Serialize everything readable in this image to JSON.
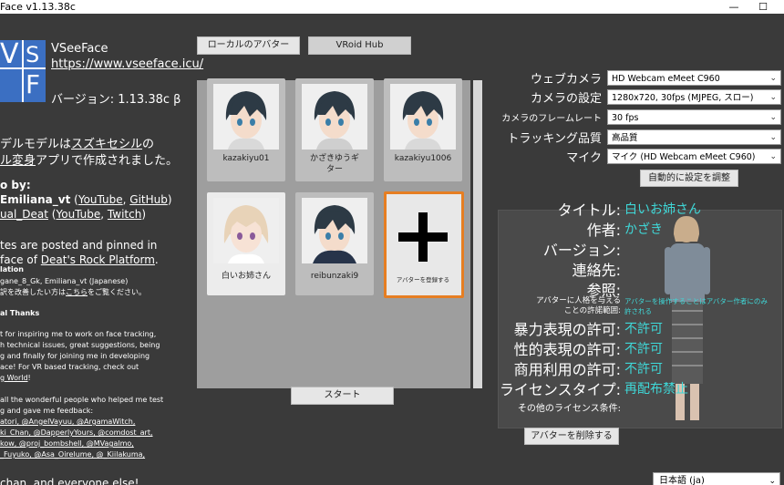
{
  "window": {
    "title": "Face v1.13.38c",
    "minimize": "—",
    "maximize": "☐"
  },
  "logo": {
    "letters": [
      "V",
      "S",
      "F"
    ]
  },
  "left": {
    "app_name": "VSeeFace",
    "url": "https://www.vseeface.icu/",
    "version": "バージョン: 1.13.38c β",
    "desc_line1_a": "デルモデルは",
    "desc_line1_link": "スズキセシル",
    "desc_line1_b": "の",
    "desc_line2_link": "ル変身",
    "desc_line2_b": "アプリで作成されました。",
    "credit_head": "o by:",
    "credit_l1_a": "Emiliana_vt",
    "credit_l1_b": " (",
    "credit_l1_yt": "YouTube",
    "credit_l1_c": ", ",
    "credit_l1_gh": "GitHub",
    "credit_l1_d": ")",
    "credit_l2_a": "ual_Deat",
    "credit_l2_b": " (",
    "credit_l2_yt": "YouTube",
    "credit_l2_c": ", ",
    "credit_l2_tw": "Twitch",
    "credit_l2_d": ")",
    "updates_l1": "tes are posted and pinned in",
    "updates_l2_a": "face of ",
    "updates_l2_link": "Deat's Rock Platform",
    "updates_l2_b": ".",
    "translation_head": "lation",
    "translation_l1": "gane_8_Gk, Emiliana_vt (Japanese)",
    "translation_l2_a": "訳を改善したい方は",
    "translation_l2_link": "こちら",
    "translation_l2_b": "をご覧ください。",
    "thanks_head": "al Thanks",
    "thanks_lines": [
      "t for inspiring me to work on face tracking,",
      "h technical issues, great suggestions, being",
      "g and finally for joining me in developing",
      "ace! For VR based tracking, check out"
    ],
    "thanks_last_a": "g World",
    "thanks_last_b": "!",
    "testers_lines": [
      "all the wonderful people who helped me test",
      "g and gave me feedback:",
      "atori, @AngelVayuu, @ArgamaWitch,",
      "ki_Chan, @DapperlyYours, @comdost_art,",
      "kow, @proj_bombshell, @MVagalmo,",
      "_Fuyuko, @Asa_Oirelume, @_Kiilakuma,"
    ],
    "everyone_a": "chan",
    "everyone_b": ", and everyone else!"
  },
  "tabs": {
    "local": "ローカルのアバター",
    "vroid": "VRoid Hub"
  },
  "avatars": [
    {
      "name": "kazakiyu01"
    },
    {
      "name": "かざきゆうギター"
    },
    {
      "name": "kazakiyu1006"
    },
    {
      "name": "白いお姉さん"
    },
    {
      "name": "reibunzaki9"
    }
  ],
  "add_avatar_label": "アバターを登録する",
  "start_button": "スタート",
  "settings": {
    "webcam_label": "ウェブカメラ",
    "webcam_value": "HD Webcam eMeet C960",
    "camera_settings_label": "カメラの設定",
    "camera_settings_value": "1280x720, 30fps (MJPEG, スロー)",
    "framerate_label": "カメラのフレームレート",
    "framerate_value": "30 fps",
    "quality_label": "トラッキング品質",
    "quality_value": "高品質",
    "mic_label": "マイク",
    "mic_value": "マイク (HD Webcam eMeet C960)",
    "auto_adjust": "自動的に設定を調整",
    "arrow": "⌄"
  },
  "avatar_info": {
    "title_label": "タイトル:",
    "title_value": "白いお姉さん",
    "author_label": "作者:",
    "author_value": "かざき",
    "version_label": "バージョン:",
    "contact_label": "連絡先:",
    "reference_label": "参照:",
    "persona_label_1": "アバターに人格を与える",
    "persona_label_2": "ことの許諾範囲:",
    "persona_value_1": "アバターを操作することはアバター作者にのみ",
    "persona_value_2": "許される",
    "violence_label": "暴力表現の許可:",
    "violence_value": "不許可",
    "sexual_label": "性的表現の許可:",
    "sexual_value": "不許可",
    "commercial_label": "商用利用の許可:",
    "commercial_value": "不許可",
    "license_label": "ライセンスタイプ:",
    "license_value": "再配布禁止",
    "other_license_label": "その他のライセンス条件:"
  },
  "delete_avatar": "アバターを削除する",
  "language": "日本語 (ja)",
  "colors": {
    "accent_value": "#3fd8d8",
    "add_border": "#e67e22",
    "logo_blue": "#3b6fc2"
  }
}
